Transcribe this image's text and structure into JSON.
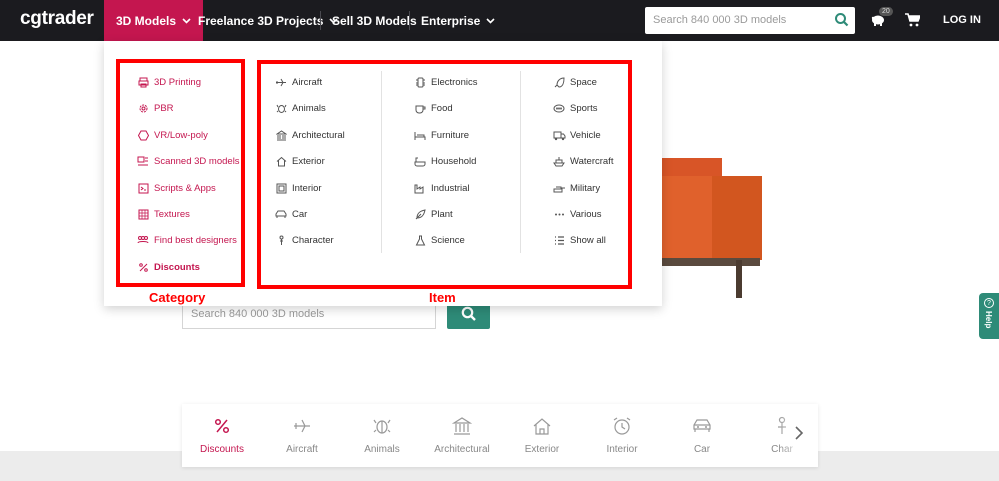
{
  "nav": {
    "logo": "cgtrader",
    "items": [
      {
        "label": "3D Models"
      },
      {
        "label": "Freelance 3D Projects"
      },
      {
        "label": "Sell 3D Models"
      },
      {
        "label": "Enterprise"
      }
    ],
    "search_placeholder": "Search 840 000 3D models",
    "notification_count": "20",
    "login_label": "LOG IN"
  },
  "hero": {
    "search_placeholder": "Search 840 000 3D models"
  },
  "help_label": "Help",
  "dropdown": {
    "categories": [
      {
        "label": "3D Printing",
        "icon": "printer-icon"
      },
      {
        "label": "PBR",
        "icon": "gear-icon"
      },
      {
        "label": "VR/Low-poly",
        "icon": "hexagon-icon"
      },
      {
        "label": "Scanned 3D models",
        "icon": "scan-icon"
      },
      {
        "label": "Scripts & Apps",
        "icon": "script-icon"
      },
      {
        "label": "Textures",
        "icon": "texture-icon"
      },
      {
        "label": "Find best designers",
        "icon": "people-icon"
      },
      {
        "label": "Discounts",
        "icon": "percent-icon"
      }
    ],
    "items_col1": [
      {
        "label": "Aircraft",
        "icon": "airplane-icon"
      },
      {
        "label": "Animals",
        "icon": "animal-icon"
      },
      {
        "label": "Architectural",
        "icon": "building-icon"
      },
      {
        "label": "Exterior",
        "icon": "house-icon"
      },
      {
        "label": "Interior",
        "icon": "frame-icon"
      },
      {
        "label": "Car",
        "icon": "car-icon"
      },
      {
        "label": "Character",
        "icon": "character-icon"
      }
    ],
    "items_col2": [
      {
        "label": "Electronics",
        "icon": "chip-icon"
      },
      {
        "label": "Food",
        "icon": "cup-icon"
      },
      {
        "label": "Furniture",
        "icon": "bed-icon"
      },
      {
        "label": "Household",
        "icon": "bathtub-icon"
      },
      {
        "label": "Industrial",
        "icon": "factory-icon"
      },
      {
        "label": "Plant",
        "icon": "leaf-icon"
      },
      {
        "label": "Science",
        "icon": "flask-icon"
      }
    ],
    "items_col3": [
      {
        "label": "Space",
        "icon": "rocket-icon"
      },
      {
        "label": "Sports",
        "icon": "ball-icon"
      },
      {
        "label": "Vehicle",
        "icon": "truck-icon"
      },
      {
        "label": "Watercraft",
        "icon": "ship-icon"
      },
      {
        "label": "Military",
        "icon": "tank-icon"
      },
      {
        "label": "Various",
        "icon": "dots-icon"
      },
      {
        "label": "Show all",
        "icon": "list-icon"
      }
    ]
  },
  "annotations": {
    "category_label": "Category",
    "item_label": "Item"
  },
  "bottom_bar": {
    "items": [
      {
        "label": "Discounts",
        "icon": "percent-icon"
      },
      {
        "label": "Aircraft",
        "icon": "airplane-icon"
      },
      {
        "label": "Animals",
        "icon": "animal-icon"
      },
      {
        "label": "Architectural",
        "icon": "building-icon"
      },
      {
        "label": "Exterior",
        "icon": "house-icon"
      },
      {
        "label": "Interior",
        "icon": "alarm-clock-icon"
      },
      {
        "label": "Car",
        "icon": "car-icon"
      },
      {
        "label": "Char",
        "icon": "character-icon"
      }
    ]
  },
  "colors": {
    "brand": "#c4164f",
    "nav_bg": "#1b1b1f",
    "accent_green": "#2e8b78",
    "annotation_red": "#ff0000"
  }
}
